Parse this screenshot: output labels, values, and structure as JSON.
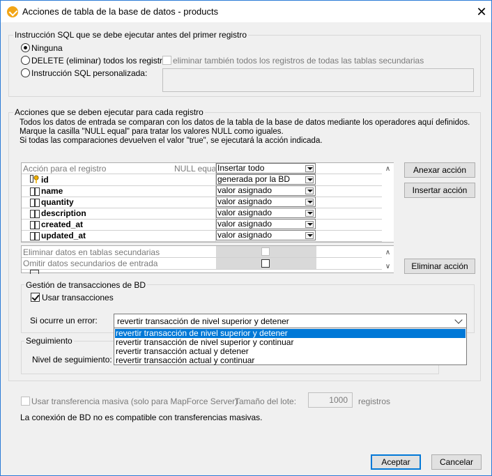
{
  "window": {
    "title": "Acciones de tabla de la base de datos - products",
    "close_glyph": "✕"
  },
  "pre_sql": {
    "group_label": "Instrucción SQL que se debe ejecutar antes del primer registro",
    "option_none": "Ninguna",
    "option_delete": "DELETE (eliminar) todos los registros",
    "option_custom": "Instrucción SQL personalizada:",
    "delete_children_label": "eliminar también todos los registros de todas las tablas secundarias",
    "selected": "Ninguna"
  },
  "per_record": {
    "group_label": "Acciones que se deben ejecutar para cada registro",
    "description_line1": "Todos los datos de entrada se comparan con los datos de la tabla de la base de datos mediante los operadores aquí definidos.",
    "description_line2": "Marque la casilla \"NULL equal\" para tratar los valores NULL como iguales.",
    "description_line3": "Si todas las comparaciones devuelven el valor \"true\", se ejecutará la acción indicada."
  },
  "grid": {
    "header_action": "Acción para el registro",
    "header_null": "NULL equal",
    "header_value": "Insertar todo",
    "rows": [
      {
        "name": "id",
        "value": "generada por la BD",
        "icon": "primary-key-icon"
      },
      {
        "name": "name",
        "value": "valor asignado",
        "icon": "field-icon"
      },
      {
        "name": "quantity",
        "value": "valor asignado",
        "icon": "field-icon"
      },
      {
        "name": "description",
        "value": "valor asignado",
        "icon": "field-icon"
      },
      {
        "name": "created_at",
        "value": "valor asignado",
        "icon": "field-icon"
      },
      {
        "name": "updated_at",
        "value": "valor asignado",
        "icon": "field-icon"
      }
    ],
    "bottom_rows": [
      {
        "label": "Eliminar datos en tablas secundarias"
      },
      {
        "label": "Omitir datos secundarios de entrada"
      }
    ]
  },
  "buttons": {
    "append_action": "Anexar acción",
    "insert_action": "Insertar acción",
    "delete_action": "Eliminar acción",
    "ok": "Aceptar",
    "cancel": "Cancelar"
  },
  "transactions": {
    "group_label": "Gestión de transacciones de BD",
    "use_transactions_label": "Usar transacciones",
    "use_transactions_checked": true,
    "on_error_label": "Si ocurre un error:",
    "on_error_value": "revertir transacción de nivel superior y detener",
    "options": [
      "revertir transacción de nivel superior y detener",
      "revertir transacción de nivel superior y continuar",
      "revertir transacción actual y detener",
      "revertir transacción actual y continuar"
    ],
    "selected_index": 0
  },
  "tracing": {
    "group_label": "Seguimiento",
    "level_label": "Nivel de seguimiento:"
  },
  "bulk": {
    "use_bulk_label": "Usar transferencia masiva (solo para MapForce Server)",
    "batch_size_label": "Tamaño del lote:",
    "batch_size_value": "1000",
    "records_label": "registros",
    "warning": "La conexión de BD no es compatible con transferencias masivas."
  },
  "colors": {
    "accent": "#0078d7",
    "title_icon": "#f2a516",
    "window_bg": "#f0f0f0"
  }
}
